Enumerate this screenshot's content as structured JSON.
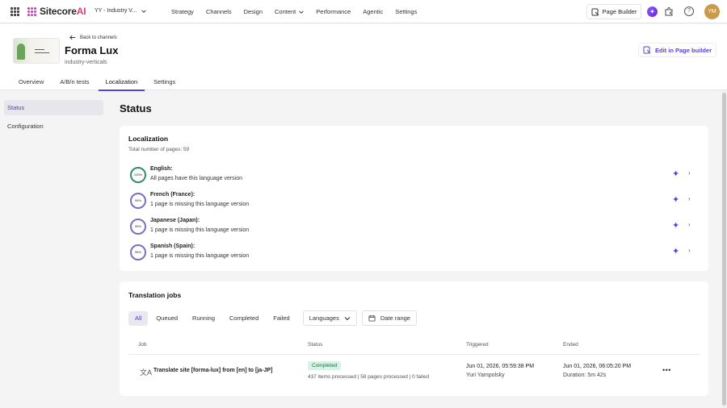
{
  "topbar": {
    "logo_main": "Sitecore",
    "logo_ai": "AI",
    "site_selector": "YY - Industry V...",
    "nav": [
      {
        "label": "Strategy"
      },
      {
        "label": "Channels"
      },
      {
        "label": "Design"
      },
      {
        "label": "Content"
      },
      {
        "label": "Performance"
      },
      {
        "label": "Agentic"
      },
      {
        "label": "Settings"
      }
    ],
    "page_builder_label": "Page Builder",
    "avatar_initials": "YM"
  },
  "header": {
    "back_label": "Back to channels",
    "title": "Forma Lux",
    "subtitle": "industry-verticals",
    "edit_label": "Edit in Page builder",
    "tabs": [
      {
        "label": "Overview"
      },
      {
        "label": "A/B/n tests"
      },
      {
        "label": "Localization"
      },
      {
        "label": "Settings"
      }
    ],
    "active_tab": "Localization"
  },
  "sidebar": {
    "items": [
      {
        "label": "Status"
      },
      {
        "label": "Configuration"
      }
    ]
  },
  "main": {
    "title": "Status",
    "localization": {
      "title": "Localization",
      "total": "Total number of pages: 59",
      "languages": [
        {
          "percent": "100%",
          "percent_value": 100,
          "name": "English:",
          "desc": "All pages have this language version"
        },
        {
          "percent": "98%",
          "percent_value": 98,
          "name": "French (France):",
          "desc": "1 page is missing this language version"
        },
        {
          "percent": "98%",
          "percent_value": 98,
          "name": "Japanese (Japan):",
          "desc": "1 page is missing this language version"
        },
        {
          "percent": "98%",
          "percent_value": 98,
          "name": "Spanish (Spain):",
          "desc": "1 page is missing this language version"
        }
      ]
    },
    "jobs": {
      "title": "Translation jobs",
      "filters": [
        {
          "label": "All"
        },
        {
          "label": "Queued"
        },
        {
          "label": "Running"
        },
        {
          "label": "Completed"
        },
        {
          "label": "Failed"
        }
      ],
      "languages_dropdown": "Languages",
      "date_range": "Date range",
      "columns": {
        "job": "Job",
        "status": "Status",
        "triggered": "Triggered",
        "ended": "Ended"
      },
      "rows": [
        {
          "job": "Translate site [forma-lux] from [en] to [ja-JP]",
          "status": "Completed",
          "status_detail": "437 items processed | 58 pages processed | 0 failed",
          "triggered_at": "Jun 01, 2026, 05:59:38 PM",
          "triggered_by": "Yuri Yampolsky",
          "ended_at": "Jun 01, 2026, 06:05:20 PM",
          "duration": "Duration: 5m 42s"
        }
      ]
    }
  },
  "colors": {
    "accent": "#5b3fd6",
    "success_bg": "#d7f3e3",
    "brand_pink": "#e4367a"
  },
  "icons": [
    "apps-grid-icon",
    "sitecore-logo-icon",
    "chevron-down-icon",
    "page-builder-icon",
    "ai-assistant-icon",
    "extension-icon",
    "help-icon",
    "arrow-left-icon",
    "sparkle-icon",
    "chevron-right-icon",
    "calendar-icon",
    "translate-icon",
    "more-icon"
  ]
}
